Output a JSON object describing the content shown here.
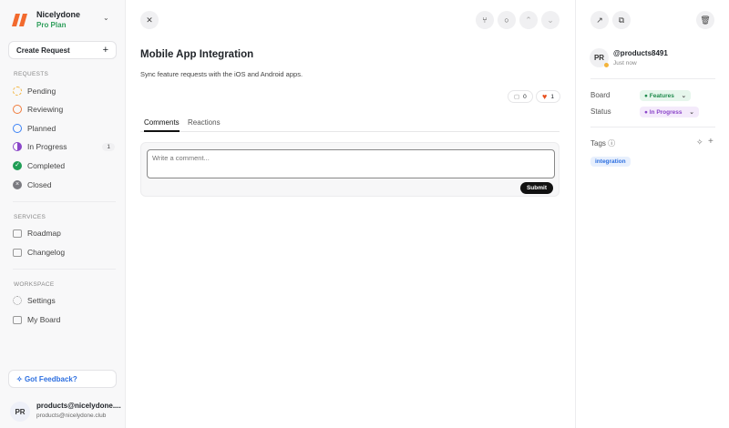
{
  "sidebar": {
    "brand": "Nicelydone",
    "plan": "Pro Plan",
    "create": "Create Request",
    "requests_title": "REQUESTS",
    "requests": [
      {
        "label": "Pending",
        "color": "#f3b43c"
      },
      {
        "label": "Reviewing",
        "color": "#f07b3c"
      },
      {
        "label": "Planned",
        "color": "#3b82f6"
      },
      {
        "label": "In Progress",
        "color": "#8b46c9",
        "count": "1"
      },
      {
        "label": "Completed",
        "color": "#1f9d55"
      },
      {
        "label": "Closed",
        "color": "#7a7a80"
      }
    ],
    "services_title": "SERVICES",
    "services": [
      "Roadmap",
      "Changelog"
    ],
    "workspace_title": "WORKSPACE",
    "workspace": [
      "Settings",
      "My Board"
    ],
    "feedback": "Got Feedback?",
    "user": {
      "initials": "PR",
      "name": "products@nicelydone....",
      "email": "products@nicelydone.club"
    }
  },
  "main": {
    "title": "Mobile App Integration",
    "description": "Sync feature requests with the iOS and Android apps.",
    "comments_count": "0",
    "reactions_count": "1",
    "tabs": [
      "Comments",
      "Reactions"
    ],
    "comment_placeholder": "Write a comment...",
    "submit": "Submit"
  },
  "details": {
    "initials": "PR",
    "username": "@products8491",
    "time": "Just now",
    "board_label": "Board",
    "board": "Features",
    "status_label": "Status",
    "status": "In Progress",
    "tags_label": "Tags",
    "tags": [
      "integration"
    ]
  }
}
